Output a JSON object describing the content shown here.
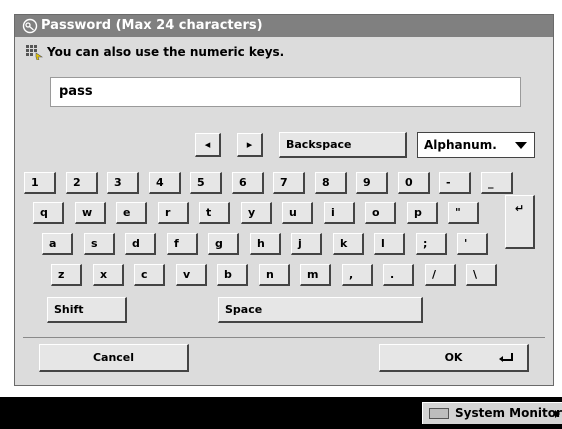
{
  "dialog": {
    "title": "Password (Max 24 characters)",
    "hint": "You can also use the numeric keys.",
    "password_value": "pass"
  },
  "controls": {
    "cursor_left": "◂",
    "cursor_right": "▸",
    "backspace": "Backspace",
    "input_mode": "Alphanum."
  },
  "keyboard": {
    "row1": [
      "1",
      "2",
      "3",
      "4",
      "5",
      "6",
      "7",
      "8",
      "9",
      "0",
      "-",
      "_"
    ],
    "row2": [
      "q",
      "w",
      "e",
      "r",
      "t",
      "y",
      "u",
      "i",
      "o",
      "p",
      "\""
    ],
    "row3": [
      "a",
      "s",
      "d",
      "f",
      "g",
      "h",
      "j",
      "k",
      "l",
      ";",
      "'"
    ],
    "row4": [
      "z",
      "x",
      "c",
      "v",
      "b",
      "n",
      "m",
      ",",
      ".",
      "/",
      "\\"
    ],
    "shift": "Shift",
    "space": "Space",
    "enter": "↵"
  },
  "footer": {
    "cancel": "Cancel",
    "ok": "OK"
  },
  "taskbar": {
    "system_monitor": "System Monitor"
  }
}
